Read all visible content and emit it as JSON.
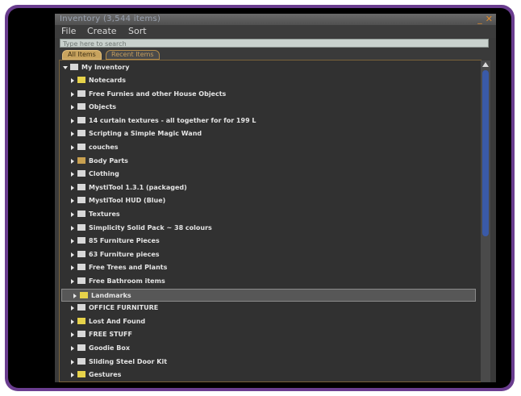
{
  "window": {
    "title": "Inventory (3,544 items)",
    "minimize_label": "_",
    "close_label": "✕"
  },
  "menu": {
    "items": [
      "File",
      "Create",
      "Sort"
    ]
  },
  "search": {
    "placeholder": "Type here to search"
  },
  "tabs": {
    "items": [
      "All Items",
      "Recent Items"
    ],
    "active": 0
  },
  "tree": {
    "root": "My Inventory",
    "selected_index": 18,
    "items": [
      {
        "label": "Notecards",
        "icon": "notecard-folder-icon",
        "color": "#e6d24a"
      },
      {
        "label": "Free Furnies and other House Objects",
        "icon": "folder-icon",
        "color": "#d8d8d8"
      },
      {
        "label": "Objects",
        "icon": "objects-folder-icon",
        "color": "#d8d8d8"
      },
      {
        "label": "14 curtain textures - all together for for 199 L",
        "icon": "folder-icon",
        "color": "#d8d8d8"
      },
      {
        "label": "Scripting a Simple Magic Wand",
        "icon": "folder-icon",
        "color": "#d8d8d8"
      },
      {
        "label": "couches",
        "icon": "folder-icon",
        "color": "#d8d8d8"
      },
      {
        "label": "Body Parts",
        "icon": "body-parts-folder-icon",
        "color": "#c8a050"
      },
      {
        "label": "Clothing",
        "icon": "clothing-folder-icon",
        "color": "#d8d8d8"
      },
      {
        "label": "MystiTool 1.3.1 (packaged)",
        "icon": "folder-icon",
        "color": "#d8d8d8"
      },
      {
        "label": "MystiTool HUD (Blue)",
        "icon": "folder-icon",
        "color": "#d8d8d8"
      },
      {
        "label": "Textures",
        "icon": "textures-folder-icon",
        "color": "#d8d8d8"
      },
      {
        "label": "Simplicity Solid Pack ~ 38 colours",
        "icon": "folder-icon",
        "color": "#d8d8d8"
      },
      {
        "label": "85 Furniture Pieces",
        "icon": "folder-icon",
        "color": "#d8d8d8"
      },
      {
        "label": "63 Furniture pieces",
        "icon": "folder-icon",
        "color": "#d8d8d8"
      },
      {
        "label": "Free Trees and Plants",
        "icon": "folder-icon",
        "color": "#d8d8d8"
      },
      {
        "label": "Free Bathroom items",
        "icon": "folder-icon",
        "color": "#d8d8d8"
      },
      {
        "label": "Landmarks",
        "icon": "landmarks-folder-icon",
        "color": "#e6d24a"
      },
      {
        "label": "OFFICE FURNITURE",
        "icon": "folder-icon",
        "color": "#d8d8d8"
      },
      {
        "label": "Lost And Found",
        "icon": "lost-and-found-folder-icon",
        "color": "#e6d24a"
      },
      {
        "label": "FREE STUFF",
        "icon": "folder-icon",
        "color": "#d8d8d8"
      },
      {
        "label": "Goodie Box",
        "icon": "folder-icon",
        "color": "#d8d8d8"
      },
      {
        "label": "Sliding Steel Door Kit",
        "icon": "folder-icon",
        "color": "#d8d8d8"
      },
      {
        "label": "Gestures",
        "icon": "gestures-folder-icon",
        "color": "#e6d24a"
      }
    ]
  },
  "colors": {
    "frame": "#6a3d8f",
    "accent_gold": "#c8a35e",
    "scroll_thumb": "#3a5aa8",
    "close_orange": "#e08a2a"
  }
}
